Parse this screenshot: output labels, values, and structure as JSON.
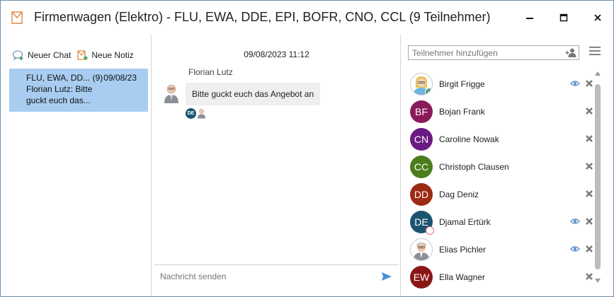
{
  "window": {
    "title": "Firmenwagen (Elektro) - FLU, EWA, DDE, EPI, BOFR, CNO, CCL (9 Teilnehmer)"
  },
  "left": {
    "new_chat_label": "Neuer Chat",
    "new_note_label": "Neue Notiz",
    "chats": [
      {
        "title": "FLU, EWA, DD...",
        "count": "(9)",
        "date": "09/08/23",
        "preview_line1": "Florian Lutz: Bitte",
        "preview_line2": "guckt euch das..."
      }
    ]
  },
  "conversation": {
    "date": "09/08/2023 11:12",
    "sender": "Florian Lutz",
    "message": "Bitte guckt euch das Angebot an",
    "read_by_initials": "DE",
    "compose_placeholder": "Nachricht senden"
  },
  "participants_panel": {
    "add_placeholder": "Teilnehmer hinzufügen",
    "participants": [
      {
        "initials": "",
        "name": "Birgit Frigge",
        "color": "#ffffff",
        "avatar": "photo-woman",
        "status": "online",
        "watching": true
      },
      {
        "initials": "BF",
        "name": "Bojan Frank",
        "color": "#8b1a5a",
        "status": "",
        "watching": false
      },
      {
        "initials": "CN",
        "name": "Caroline Nowak",
        "color": "#6a1a82",
        "status": "",
        "watching": false
      },
      {
        "initials": "CC",
        "name": "Christoph Clausen",
        "color": "#4b7d1d",
        "status": "",
        "watching": false
      },
      {
        "initials": "DD",
        "name": "Dag Deniz",
        "color": "#9c2a14",
        "status": "",
        "watching": false
      },
      {
        "initials": "DE",
        "name": "Djamal Ertürk",
        "color": "#1c5470",
        "status": "blocked",
        "watching": true
      },
      {
        "initials": "",
        "name": "Elias Pichler",
        "color": "#ffffff",
        "avatar": "photo-man-old",
        "status": "",
        "watching": true
      },
      {
        "initials": "EW",
        "name": "Ella Wagner",
        "color": "#8a1616",
        "status": "",
        "watching": false
      }
    ]
  },
  "colors": {
    "selected_chat": "#a8cdf0",
    "send": "#4a90d9",
    "eye": "#5b8fc9",
    "remove": "#7a7a7a"
  }
}
